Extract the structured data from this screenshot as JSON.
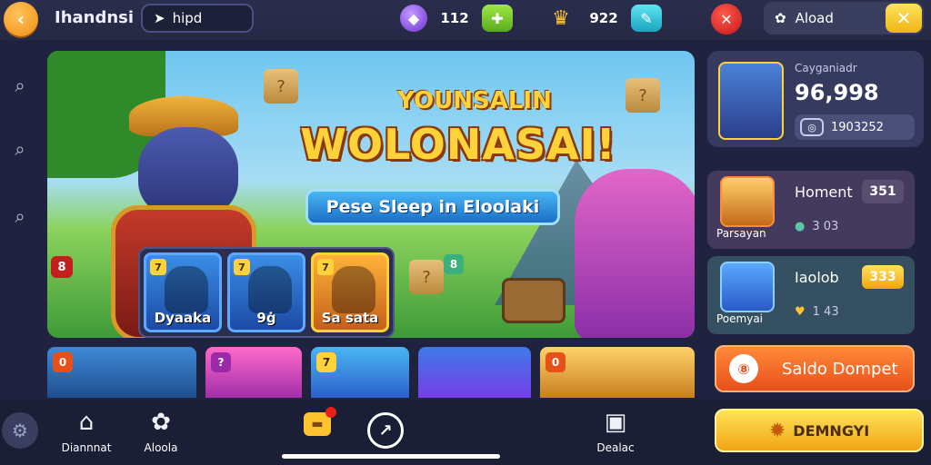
{
  "topbar": {
    "back_icon": "back-arrow-icon",
    "title": "Ihandnsi",
    "mode_value": "hipd",
    "gems_value": "112",
    "crowns_value": "922",
    "close_icon": "close-icon",
    "profile_name": "Aload",
    "profile_x": "✕"
  },
  "banner": {
    "headline_top": "YOUNSALIN",
    "headline_main": "WOLONASAI!",
    "tagline": "Pese Sleep in Eloolaki",
    "hero_badge": "8",
    "side_badge": "8",
    "characters": [
      {
        "num": "7",
        "label": "Dyaaka"
      },
      {
        "num": "7",
        "label": "9ġ"
      },
      {
        "num": "7",
        "label": "Sa sata"
      }
    ]
  },
  "heroes": [
    {
      "badge": "0"
    },
    {
      "badge": "?"
    },
    {
      "badge": "7"
    },
    {
      "badge": ""
    },
    {
      "badge": "0"
    }
  ],
  "rank": {
    "label": "Cayganiadr",
    "value": "96,998",
    "sub": "1903252"
  },
  "offers": [
    {
      "sub": "Parsayan",
      "name": "Homent",
      "price": "351",
      "meta": "3 03"
    },
    {
      "sub": "Poemyai",
      "name": "Iaolob",
      "price": "333",
      "meta": "1 43"
    }
  ],
  "saldo_label": "Saldo Dompet",
  "nav": [
    {
      "label": "Diannnat",
      "icon": "home-icon"
    },
    {
      "label": "Aloola",
      "icon": "puzzle-icon"
    },
    {
      "label": "Dealac",
      "icon": "shop-icon"
    }
  ],
  "dem_label": "DEMNGYI"
}
